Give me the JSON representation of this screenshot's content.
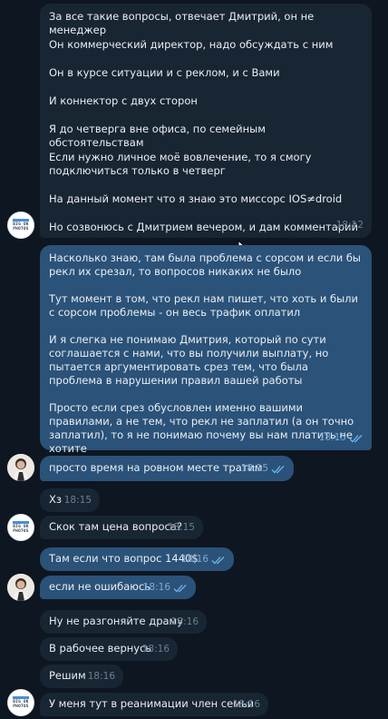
{
  "messages": {
    "m1": {
      "paras": [
        "За все такие вопросы, отвечает Дмитрий, он не менеджер",
        "Он коммерческий директор, надо обсуждать с ним",
        "Он в курсе ситуации и с реклом, и с Вами",
        "И коннектор с двух сторон",
        "Я до четверга вне офиса, по семейным обстоятельствам",
        "Если нужно личное моё вовлечение, то я смогу подключиться только в четверг",
        "На данный момент что я знаю это миссорс IOS≠droid",
        "Но созвонюсь с Дмитрием вечером, и дам комментарий"
      ],
      "time": "18:12"
    },
    "m2": {
      "paras": [
        "Насколько знаю, там была проблема с сорсом и если бы рекл их срезал, то вопросов никаких не было",
        "Тут момент в том, что рекл нам пишет, что хоть и были с сорсом проблемы - он весь трафик оплатил",
        "И я слегка не понимаю Дмитрия, который по сути соглашается с нами, что вы получили выплату, но пытается аргументировать срез тем, что была проблема в нарушении правил вашей работы",
        "Просто если срез обусловлен именно вашими правилами, а не тем, что рекл не заплатил (а он точно заплатил), то я не понимаю почему вы нам платить не хотите"
      ],
      "time": "18:15"
    },
    "m3": {
      "text": "просто время на ровном месте тратим",
      "time": "18:15"
    },
    "m4": {
      "text": "Хз",
      "time": "18:15"
    },
    "m5": {
      "text": "Скок там цена вопроса?",
      "time": "18:15"
    },
    "m6": {
      "text": "Там если что вопрос 1440$",
      "time": "18:16"
    },
    "m7": {
      "text": "если не ошибаюсь",
      "time": "18:16"
    },
    "m8": {
      "text": "Ну не разгоняйте драму",
      "time": "18:16"
    },
    "m9": {
      "text": "В рабочее вернусь",
      "time": "18:16"
    },
    "m10": {
      "text": "Решим",
      "time": "18:16"
    },
    "m11": {
      "text": "У меня тут в реанимации член семьи",
      "time": "18:16"
    }
  },
  "avatar_logo_text": [
    "BIG OK",
    "PHOTOS"
  ],
  "colors": {
    "background": "#0e1621",
    "incoming_bubble": "#182533",
    "outgoing_bubble": "#2b5278",
    "time_in": "#6d7f8f",
    "time_out": "#7da8d3",
    "read_check": "#6fb3ee"
  },
  "icons": {
    "read_receipt": "double-check-icon",
    "cursor": "mouse-pointer-icon"
  }
}
